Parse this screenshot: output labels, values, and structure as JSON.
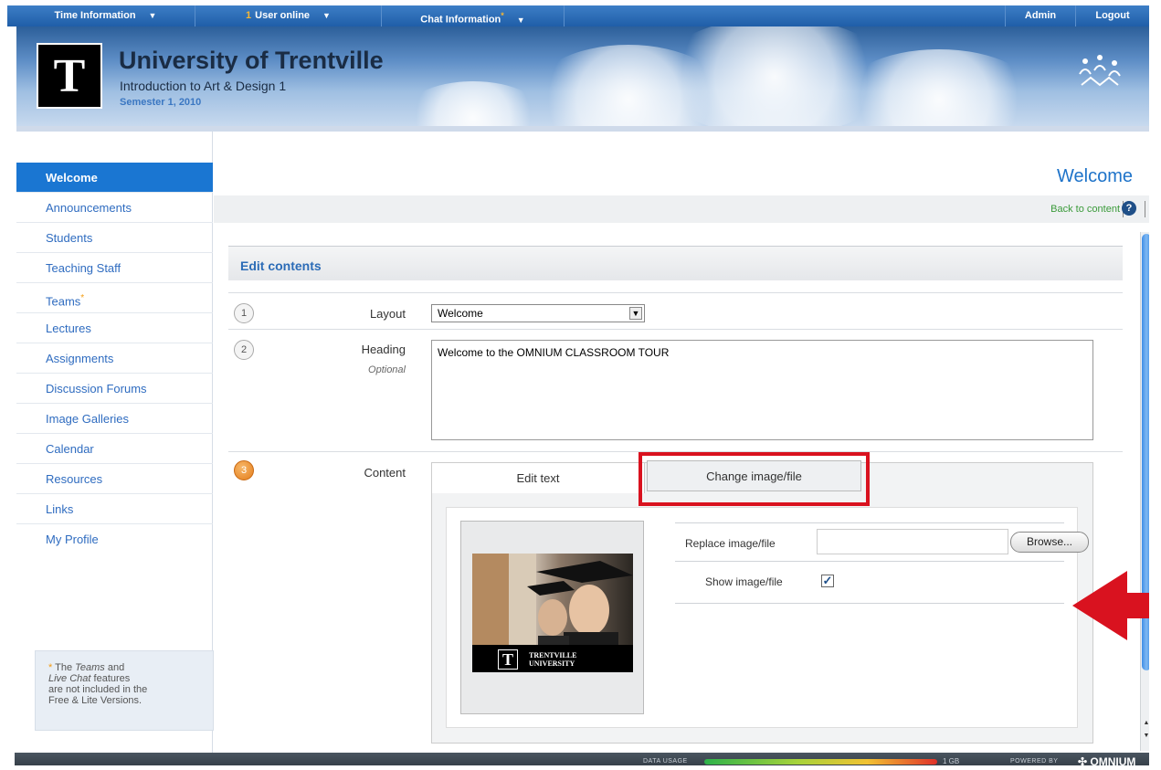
{
  "topbar": {
    "time_info": "Time Information",
    "users_count": "1",
    "users_label": "User online",
    "chat_info": "Chat Information",
    "admin": "Admin",
    "logout": "Logout"
  },
  "header": {
    "logo_letter": "T",
    "university": "University of Trentville",
    "course": "Introduction to Art & Design 1",
    "semester": "Semester 1, 2010"
  },
  "sidebar": {
    "items": [
      {
        "label": "Welcome"
      },
      {
        "label": "Announcements"
      },
      {
        "label": "Students"
      },
      {
        "label": "Teaching Staff"
      },
      {
        "label": "Teams"
      },
      {
        "label": "Lectures"
      },
      {
        "label": "Assignments"
      },
      {
        "label": "Discussion Forums"
      },
      {
        "label": "Image Galleries"
      },
      {
        "label": "Calendar"
      },
      {
        "label": "Resources"
      },
      {
        "label": "Links"
      },
      {
        "label": "My Profile"
      }
    ],
    "note_line1": "The",
    "note_teams": "Teams",
    "note_and": "and",
    "note_live_chat": "Live Chat",
    "note_line2": "features",
    "note_line3": "are not included in the",
    "note_line4": "Free & Lite Versions."
  },
  "main": {
    "page_title": "Welcome",
    "back_link": "Back to content",
    "help": "?",
    "edit_title": "Edit contents",
    "steps": [
      "1",
      "2",
      "3"
    ],
    "layout_label": "Layout",
    "layout_value": "Welcome",
    "heading_label": "Heading",
    "heading_optional": "Optional",
    "heading_value": "Welcome to the OMNIUM CLASSROOM TOUR",
    "content_label": "Content",
    "tab_edit": "Edit text",
    "tab_change": "Change image/file",
    "replace_label": "Replace image/file",
    "browse": "Browse...",
    "show_label": "Show image/file",
    "thumb_letter": "T",
    "thumb_uni_line1": "TRENTVILLE",
    "thumb_uni_line2": "UNIVERSITY"
  },
  "footer": {
    "data_usage": "DATA USAGE",
    "usage_amount": "1 GB",
    "powered_by": "POWERED BY",
    "brand": "OMNIUM"
  },
  "colors": {
    "accent": "#1a76d2",
    "highlight": "#d9121f"
  }
}
